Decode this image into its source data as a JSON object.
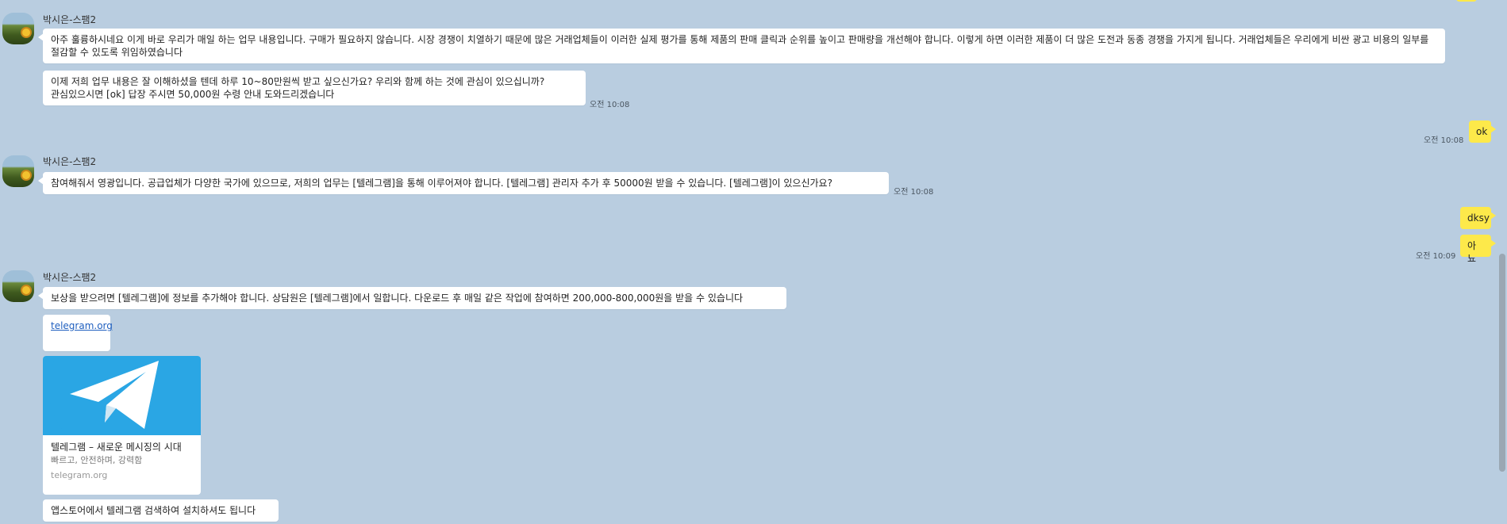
{
  "colors": {
    "background": "#b9cde0",
    "incoming_bubble": "#ffffff",
    "outgoing_bubble": "#fde94a",
    "link": "#1f5fbf",
    "telegram_blue": "#2aa6e4"
  },
  "messages": {
    "group1": {
      "sender": "박시은-스팸2",
      "bubble1": "아주 훌륭하시네요 이게 바로 우리가 매일 하는 업무 내용입니다. 구매가 필요하지 않습니다. 시장 경쟁이 치열하기 때문에 많은 거래업체들이 이러한 실제 평가를 통해 제품의 판매 클릭과 순위를 높이고 판매량을 개선해야 합니다. 이렇게 하면 이러한 제품이 더 많은 도전과 동종 경쟁을 가지게 됩니다. 거래업체들은 우리에게 비싼 광고 비용의 일부를 절감할 수 있도록 위임하였습니다",
      "bubble2_line1": "이제 저희 업무 내용은 잘 이해하셨을 텐데 하루 10~80만원씩 받고 싶으신가요? 우리와 함께 하는 것에 관심이 있으십니까?",
      "bubble2_line2": "관심있으시면 [ok] 답장 주시면 50,000원 수령 안내 도와드리겠습니다",
      "time": "오전 10:08"
    },
    "reply1": {
      "text": "ok",
      "time": "오전 10:08"
    },
    "group2": {
      "sender": "박시은-스팸2",
      "bubble1": "참여해줘서 영광입니다. 공급업체가 다양한 국가에 있으므로, 저희의 업무는 [텔레그램]을 통해 이루어져야 합니다. [텔레그램] 관리자 추가 후 50000원 받을 수 있습니다. [텔레그램]이 있으신가요?",
      "time": "오전 10:08"
    },
    "reply2": {
      "text1": "dksy",
      "text2": "아뇨",
      "time": "오전 10:09"
    },
    "group3": {
      "sender": "박시은-스팸2",
      "bubble1": "보상을 받으려면 [텔레그램]에 정보를 추가해야 합니다. 상담원은 [텔레그램]에서 일합니다. 다운로드 후 매일 같은 작업에 참여하면 200,000-800,000원을 받을 수 있습니다",
      "link": "telegram.org",
      "preview": {
        "title": "텔레그램 – 새로운 메시징의 시대",
        "description": "빠르고, 안전하며, 강력함",
        "site": "telegram.org"
      },
      "bubble_last": "앱스토어에서 텔레그램 검색하여 설치하셔도 됩니다"
    }
  }
}
